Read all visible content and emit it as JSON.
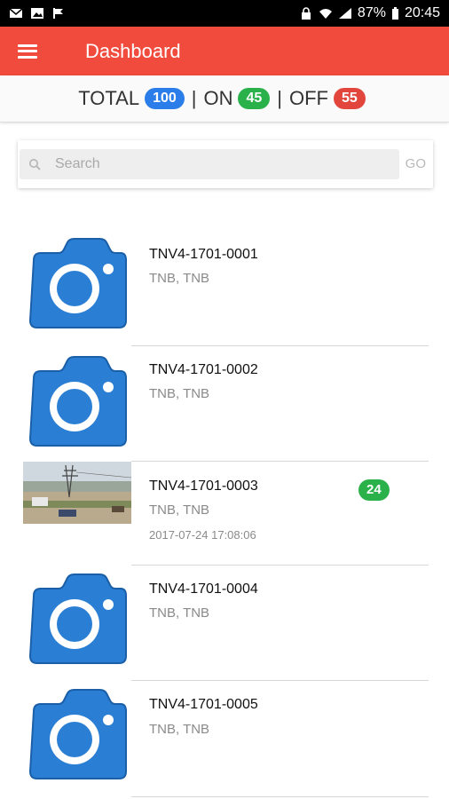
{
  "status_bar": {
    "battery": "87%",
    "time": "20:45"
  },
  "header": {
    "title": "Dashboard"
  },
  "summary": {
    "total_label": "TOTAL",
    "total_value": "100",
    "separator": "|",
    "on_label": "ON",
    "on_value": "45",
    "off_label": "OFF",
    "off_value": "55"
  },
  "search": {
    "placeholder": "Search",
    "go_label": "GO"
  },
  "colors": {
    "appbar": "#f04b3d",
    "total_pill": "#2b7de9",
    "on_pill": "#2ab14a",
    "off_pill": "#e2453c",
    "camera_icon": "#2a7fd4"
  },
  "cameras": [
    {
      "name": "TNV4-1701-0001",
      "location": "TNB, TNB",
      "icon": "camera-placeholder-icon"
    },
    {
      "name": "TNV4-1701-0002",
      "location": "TNB, TNB",
      "icon": "camera-placeholder-icon"
    },
    {
      "name": "TNV4-1701-0003",
      "location": "TNB, TNB",
      "timestamp": "2017-07-24 17:08:06",
      "badge": "24",
      "icon": "camera-snapshot-photo"
    },
    {
      "name": "TNV4-1701-0004",
      "location": "TNB, TNB",
      "icon": "camera-placeholder-icon"
    },
    {
      "name": "TNV4-1701-0005",
      "location": "TNB, TNB",
      "icon": "camera-placeholder-icon"
    }
  ]
}
